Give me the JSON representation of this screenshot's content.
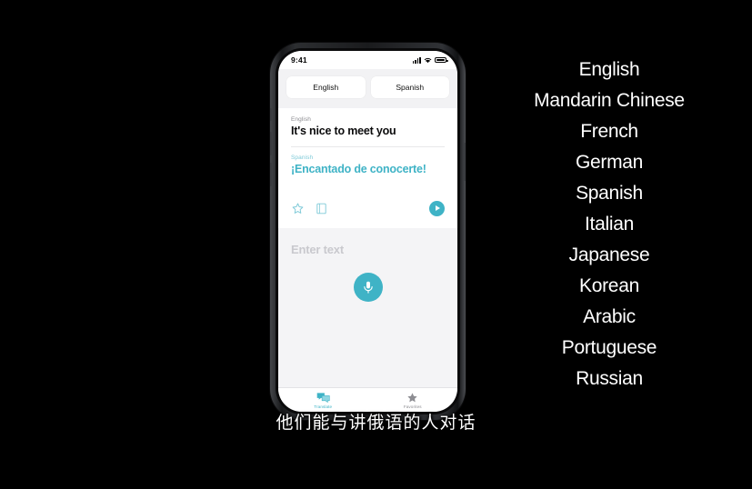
{
  "phone": {
    "status_bar": {
      "time": "9:41",
      "signal_icon": "cellular-signal-icon",
      "wifi_icon": "wifi-icon",
      "battery_icon": "battery-icon"
    },
    "language_switch": {
      "source_language": "English",
      "target_language": "Spanish"
    },
    "translation_card": {
      "source_label": "English",
      "source_text": "It's nice to meet you",
      "target_label": "Spanish",
      "target_text": "¡Encantado de conocerte!",
      "favorite_icon": "star-outline-icon",
      "dictionary_icon": "book-icon",
      "play_icon": "play-icon"
    },
    "entry_area": {
      "placeholder": "Enter text",
      "mic_icon": "microphone-icon"
    },
    "tab_bar": {
      "tabs": [
        {
          "label": "Translate",
          "icon": "speech-bubbles-icon",
          "active": true
        },
        {
          "label": "Favorites",
          "icon": "star-filled-icon",
          "active": false
        }
      ]
    }
  },
  "language_list": {
    "items": [
      "English",
      "Mandarin Chinese",
      "French",
      "German",
      "Spanish",
      "Italian",
      "Japanese",
      "Korean",
      "Arabic",
      "Portuguese",
      "Russian"
    ]
  },
  "subtitle": {
    "text": "他们能与讲俄语的人对话"
  },
  "colors": {
    "background": "#000000",
    "accent_teal": "#3fb3c6",
    "text_light": "#ffffff",
    "placeholder_gray": "#c9c9ce",
    "panel_gray": "#f4f4f6"
  }
}
